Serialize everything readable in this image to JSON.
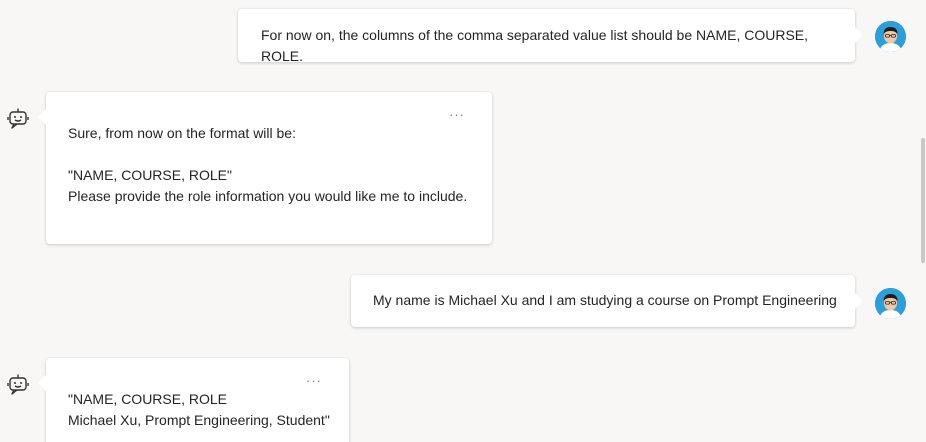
{
  "messages": [
    {
      "role": "user",
      "text": "For now on, the columns of the comma separated value list should be NAME, COURSE, ROLE."
    },
    {
      "role": "bot",
      "text": "Sure, from now on the format will be:\n\n\"NAME, COURSE, ROLE\"\nPlease provide the role information you would like me to include.",
      "more": "···"
    },
    {
      "role": "user",
      "text": "My name is Michael Xu and I am studying a course on Prompt Engineering"
    },
    {
      "role": "bot",
      "text": "\"NAME, COURSE, ROLE\nMichael Xu, Prompt Engineering, Student\"",
      "more": "···"
    }
  ],
  "icons": {
    "user_avatar": "user-avatar",
    "bot": "bot-icon",
    "more": "more-options-icon"
  },
  "colors": {
    "background": "#f8f7f6",
    "bubble": "#ffffff",
    "accent": "#5b7fc7",
    "avatar_bg": "#2b9fd9"
  }
}
